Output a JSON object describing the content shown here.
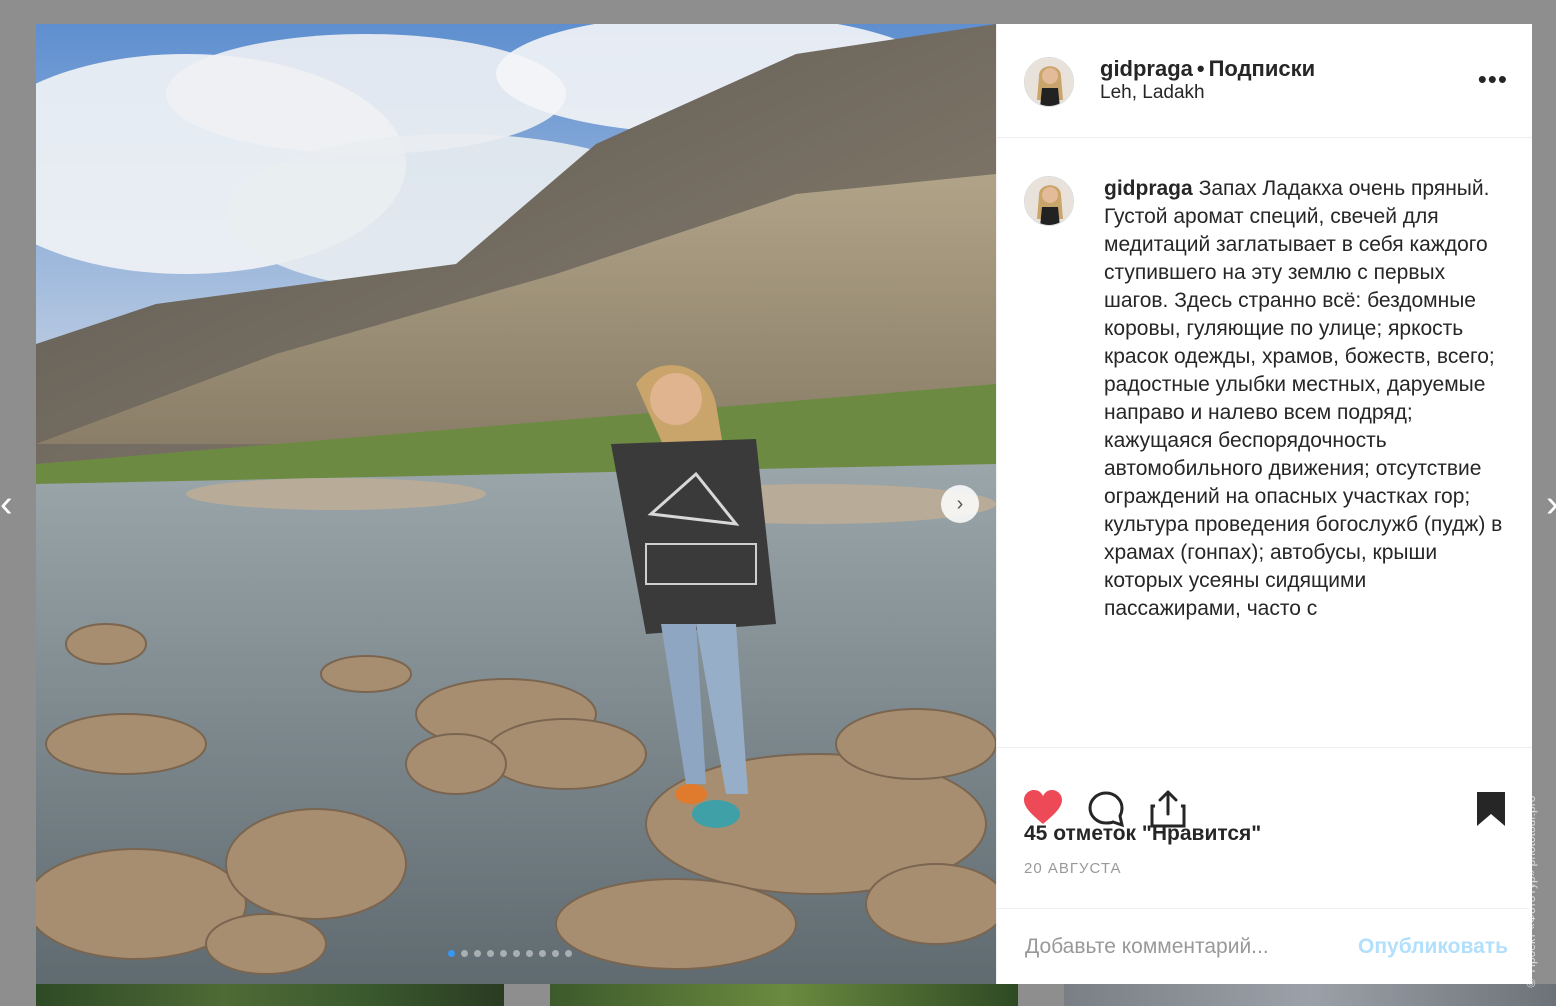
{
  "post": {
    "username": "gidpraga",
    "separator": "•",
    "follow_label": "Подписки",
    "location": "Leh, Ladakh",
    "more_icon": "more-horizontal-icon",
    "caption_user": "gidpraga",
    "caption_text": "Запах Ладакха очень пряный. Густой аромат специй, свечей для медитаций заглатывает в себя каждого ступившего на эту землю с первых шагов. Здесь странно всё: бездомные коровы, гуляющие по улице; яркость красок одежды, храмов, божеств, всего; радостные улыбки местных, даруемые направо и налево всем подряд; кажущаяся беспорядочность автомобильного движения; отсутствие ограждений на опасных участках гор; культура проведения богослужб (пудж) в храмах (гонпах); автобусы, крыши которых усеяны сидящими пассажирами, часто с",
    "likes": "45 отметок \"Нравится\"",
    "date": "20 АВГУСТА",
    "comment_placeholder": "Добавьте комментарий...",
    "publish_label": "Опубликовать"
  },
  "carousel": {
    "dot_count": 10,
    "active_index": 0,
    "next_icon": "chevron-right-icon"
  },
  "nav": {
    "prev_icon": "chevron-left-icon",
    "next_icon": "chevron-right-icon"
  },
  "watermark": "© Проект «ФотоТур» phototour.pro",
  "colors": {
    "like_red": "#ed4956",
    "link_blue": "#3897f0",
    "publish_disabled": "#b2dffc",
    "text": "#262626",
    "muted": "#999999"
  }
}
